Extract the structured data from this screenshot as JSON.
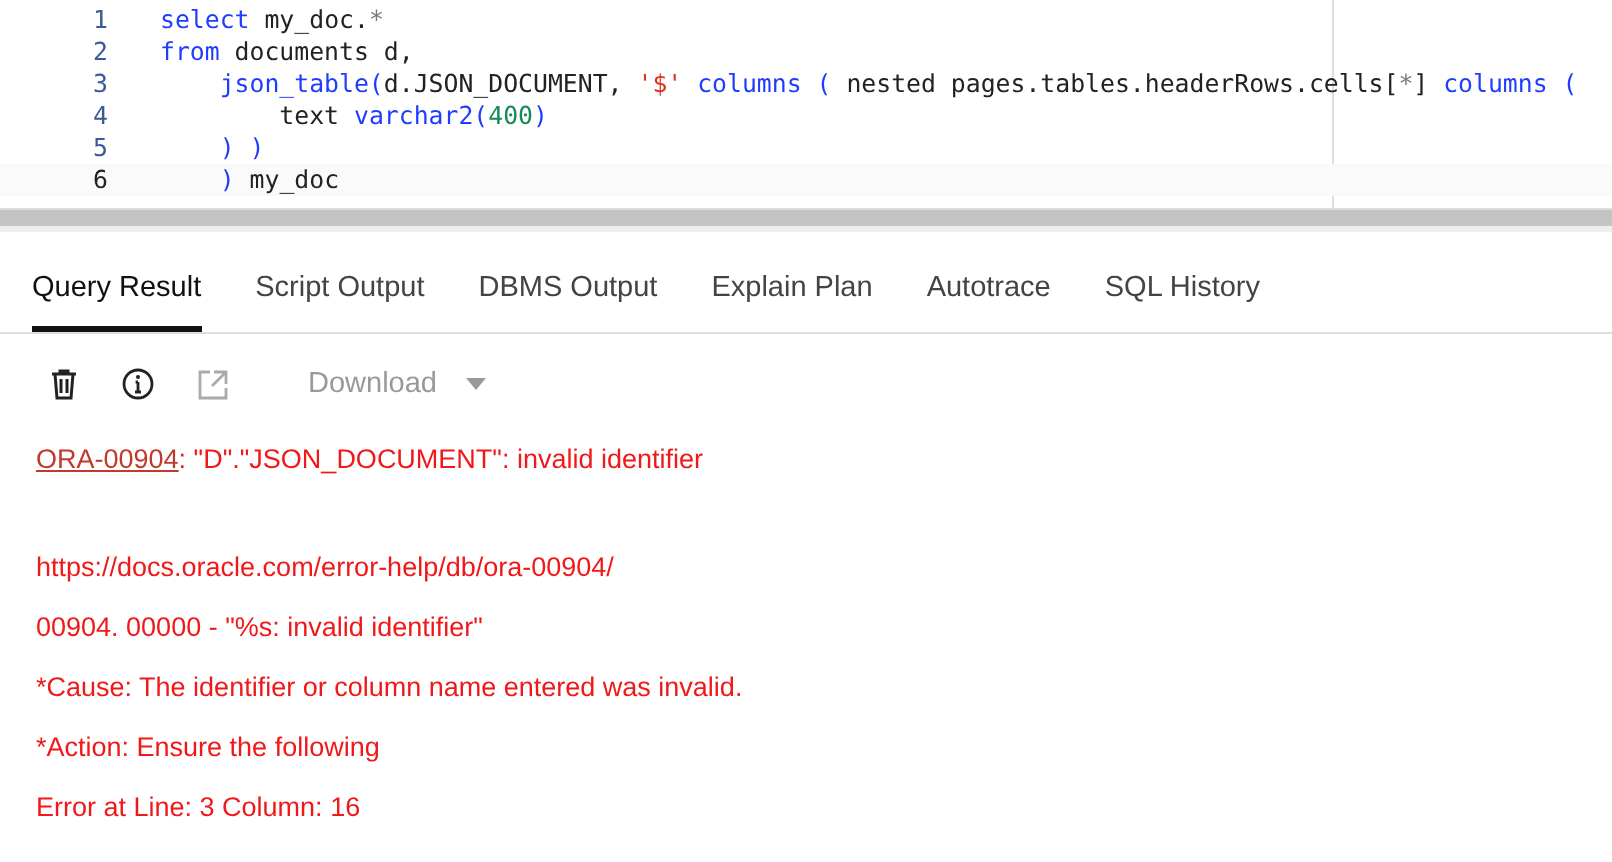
{
  "editor": {
    "lines": [
      {
        "number": "1",
        "current": false,
        "tokens": [
          {
            "kind": "keyword",
            "text": "select"
          },
          {
            "kind": "plain",
            "text": " my_doc."
          },
          {
            "kind": "operator",
            "text": "*"
          }
        ]
      },
      {
        "number": "2",
        "current": false,
        "tokens": [
          {
            "kind": "keyword",
            "text": "from"
          },
          {
            "kind": "plain",
            "text": " documents d,"
          }
        ]
      },
      {
        "number": "3",
        "current": false,
        "tokens": [
          {
            "kind": "keyword",
            "text": "    json_table("
          },
          {
            "kind": "plain",
            "text": "d.JSON_DOCUMENT, "
          },
          {
            "kind": "string",
            "text": "'$'"
          },
          {
            "kind": "keyword",
            "text": " columns ( "
          },
          {
            "kind": "plain",
            "text": "nested pages.tables.headerRows.cells["
          },
          {
            "kind": "operator",
            "text": "*"
          },
          {
            "kind": "plain",
            "text": "] "
          },
          {
            "kind": "keyword",
            "text": "columns ("
          }
        ]
      },
      {
        "number": "4",
        "current": false,
        "tokens": [
          {
            "kind": "plain",
            "text": "        text "
          },
          {
            "kind": "keyword",
            "text": "varchar2("
          },
          {
            "kind": "number",
            "text": "400"
          },
          {
            "kind": "keyword",
            "text": ")"
          }
        ]
      },
      {
        "number": "5",
        "current": false,
        "tokens": [
          {
            "kind": "keyword",
            "text": "    ) )"
          }
        ]
      },
      {
        "number": "6",
        "current": true,
        "tokens": [
          {
            "kind": "keyword",
            "text": "    )"
          },
          {
            "kind": "plain",
            "text": " my_doc"
          }
        ]
      }
    ]
  },
  "tabs": [
    {
      "label": "Query Result",
      "selected": true
    },
    {
      "label": "Script Output",
      "selected": false
    },
    {
      "label": "DBMS Output",
      "selected": false
    },
    {
      "label": "Explain Plan",
      "selected": false
    },
    {
      "label": "Autotrace",
      "selected": false
    },
    {
      "label": "SQL History",
      "selected": false
    }
  ],
  "toolbar": {
    "download": {
      "label": "Download",
      "disabled": true
    }
  },
  "messages": [
    {
      "kind": "error",
      "link": "ORA-00904",
      "text": ": \"D\".\"JSON_DOCUMENT\": invalid identifier"
    },
    {
      "kind": "detail",
      "text": "https://docs.oracle.com/error-help/db/ora-00904/"
    },
    {
      "kind": "detail",
      "text": "00904. 00000 -  \"%s: invalid identifier\""
    },
    {
      "kind": "detail",
      "text": "*Cause:    The identifier or column name entered was invalid."
    },
    {
      "kind": "detail",
      "text": "*Action:   Ensure the following"
    },
    {
      "kind": "detail",
      "text": "Error at Line: 3 Column: 16"
    }
  ]
}
